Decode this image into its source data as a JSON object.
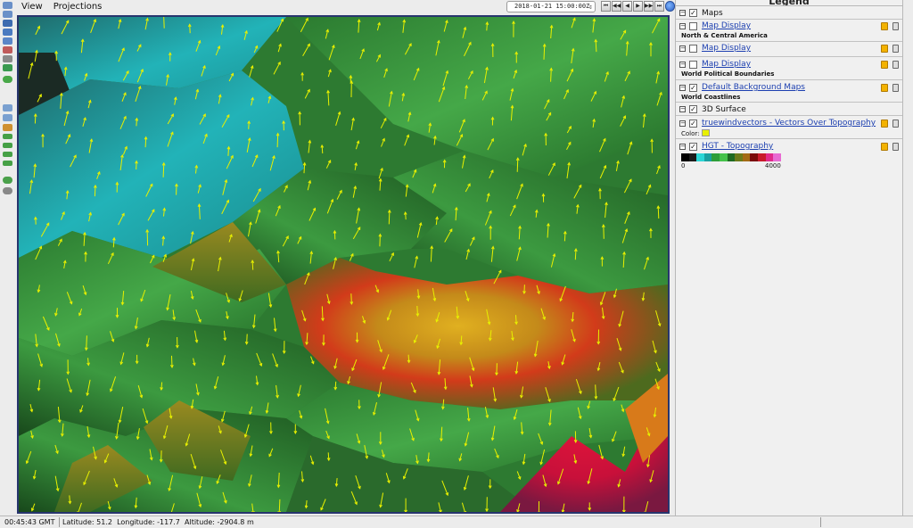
{
  "menubar": {
    "items": [
      "View",
      "Projections"
    ]
  },
  "animation": {
    "time": "2018-01-21 15:00:00Z",
    "buttons": [
      "⏮",
      "◀◀",
      "◀",
      "▶",
      "▶▶",
      "⏭"
    ]
  },
  "toolbar": {
    "icons": [
      "zoom-in-icon",
      "zoom-out-icon",
      "rotate-icon",
      "home-icon",
      "print-icon",
      "capture-icon",
      "grid-icon",
      "globe-icon",
      "refresh-icon",
      "reset-icon",
      "arrow-up-icon",
      "arrow-right-icon",
      "arrow-down-icon",
      "undo-icon",
      "magnet-icon"
    ]
  },
  "legend": {
    "title": "Legend",
    "groups": [
      {
        "label": "Maps",
        "layers": [
          {
            "name": "Map Display",
            "sublabel": "North & Central America"
          },
          {
            "name": "Map Display",
            "sublabel": ""
          },
          {
            "name": "Map Display",
            "sublabel": "World Political Boundaries"
          },
          {
            "name": "Default Background Maps",
            "sublabel": "World Coastlines"
          }
        ]
      },
      {
        "label": "3D Surface",
        "layers": [
          {
            "name": "truewindvectors - Vectors Over Topography",
            "sublabel": "Color:",
            "color": "#e8f000"
          },
          {
            "name": "HGT - Topography",
            "sublabel": ""
          }
        ]
      }
    ],
    "colorbar": {
      "min": "0",
      "max": "4000",
      "colors": [
        "#000000",
        "#1a1a1a",
        "#2bd6d6",
        "#1aa0a0",
        "#2e9e3a",
        "#45c24a",
        "#1e6a22",
        "#6b7a1a",
        "#a36a14",
        "#7a0a0a",
        "#c81a2a",
        "#e02a8a",
        "#e86ad2"
      ]
    }
  },
  "status": {
    "time": "00:45:43 GMT",
    "latitude_label": "Latitude:",
    "latitude": "51.2",
    "longitude_label": "Longitude:",
    "longitude": "-117.7",
    "altitude_label": "Altitude:",
    "altitude": "-2904.8 m"
  },
  "colors": {
    "view_border": "#27356e",
    "vector": "#e8f000",
    "link": "#1c3fb0"
  }
}
